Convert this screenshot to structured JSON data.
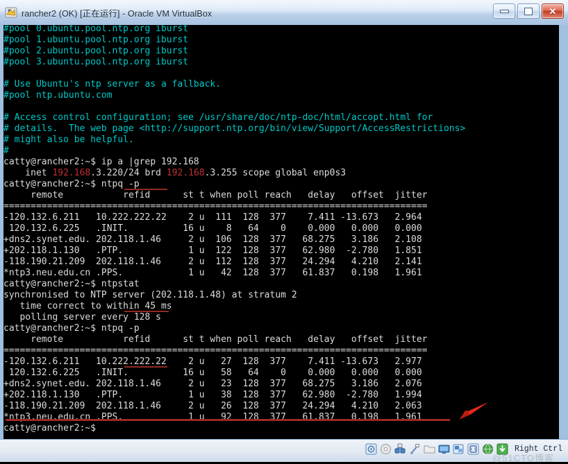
{
  "window": {
    "title": "rancher2 (OK) [正在运行] - Oracle VM VirtualBox",
    "icon": "virtualbox-icon",
    "controls": {
      "minimize": "–",
      "maximize": "□",
      "close": "✕"
    },
    "accent_blue": "#a7c3e2",
    "close_red": "#c43a22"
  },
  "terminal": {
    "background": "#000000",
    "foreground": "#d8d8d8",
    "comment_color": "#00c8c8",
    "highlight_color": "#c03030",
    "prompt": "catty@rancher2:~$",
    "lines": [
      {
        "segs": [
          {
            "t": "#pool 0.ubuntu.pool.ntp.org iburst",
            "c": "cyan"
          }
        ]
      },
      {
        "segs": [
          {
            "t": "#pool 1.ubuntu.pool.ntp.org iburst",
            "c": "cyan"
          }
        ]
      },
      {
        "segs": [
          {
            "t": "#pool 2.ubuntu.pool.ntp.org iburst",
            "c": "cyan"
          }
        ]
      },
      {
        "segs": [
          {
            "t": "#pool 3.ubuntu.pool.ntp.org iburst",
            "c": "cyan"
          }
        ]
      },
      {
        "segs": [
          {
            "t": "",
            "c": "white"
          }
        ]
      },
      {
        "segs": [
          {
            "t": "# Use Ubuntu's ntp server as a fallback.",
            "c": "cyan"
          }
        ]
      },
      {
        "segs": [
          {
            "t": "#pool ntp.ubuntu.com",
            "c": "cyan"
          }
        ]
      },
      {
        "segs": [
          {
            "t": "",
            "c": "white"
          }
        ]
      },
      {
        "segs": [
          {
            "t": "# Access control configuration; see /usr/share/doc/ntp-doc/html/accopt.html for",
            "c": "cyan"
          }
        ]
      },
      {
        "segs": [
          {
            "t": "# details.  The web page <http://support.ntp.org/bin/view/Support/AccessRestrictions>",
            "c": "cyan"
          }
        ]
      },
      {
        "segs": [
          {
            "t": "# might also be helpful.",
            "c": "cyan"
          }
        ]
      },
      {
        "segs": [
          {
            "t": "#",
            "c": "cyan"
          }
        ]
      },
      {
        "segs": [
          {
            "t": "catty@rancher2:~$ ip a |grep 192.168",
            "c": "white"
          }
        ]
      },
      {
        "segs": [
          {
            "t": "    inet ",
            "c": "white"
          },
          {
            "t": "192.168",
            "c": "red"
          },
          {
            "t": ".3.220/24 brd ",
            "c": "white"
          },
          {
            "t": "192.168",
            "c": "red"
          },
          {
            "t": ".3.255 scope global enp0s3",
            "c": "white"
          }
        ]
      },
      {
        "segs": [
          {
            "t": "catty@rancher2:~$ ntpq -p",
            "c": "white"
          }
        ]
      },
      {
        "segs": [
          {
            "t": "     remote           refid      st t when poll reach   delay   offset  jitter",
            "c": "white"
          }
        ]
      },
      {
        "segs": [
          {
            "t": "==============================================================================",
            "c": "white"
          }
        ]
      },
      {
        "segs": [
          {
            "t": "-120.132.6.211   10.222.222.22    2 u  111  128  377    7.411 -13.673   2.964",
            "c": "white"
          }
        ]
      },
      {
        "segs": [
          {
            "t": " 120.132.6.225   .INIT.          16 u    8   64    0    0.000   0.000   0.000",
            "c": "white"
          }
        ]
      },
      {
        "segs": [
          {
            "t": "+dns2.synet.edu. 202.118.1.46     2 u  106  128  377   68.275   3.186   2.108",
            "c": "white"
          }
        ]
      },
      {
        "segs": [
          {
            "t": "+202.118.1.130   .PTP.            1 u  122  128  377   62.980  -2.780   1.851",
            "c": "white"
          }
        ]
      },
      {
        "segs": [
          {
            "t": "-118.190.21.209  202.118.1.46     2 u  112  128  377   24.294   4.210   2.141",
            "c": "white"
          }
        ]
      },
      {
        "segs": [
          {
            "t": "*ntp3.neu.edu.cn .PPS.            1 u   42  128  377   61.837   0.198   1.961",
            "c": "white"
          }
        ]
      },
      {
        "segs": [
          {
            "t": "catty@rancher2:~$ ntpstat",
            "c": "white"
          }
        ]
      },
      {
        "segs": [
          {
            "t": "synchronised to NTP server (202.118.1.48) at stratum 2",
            "c": "white"
          }
        ]
      },
      {
        "segs": [
          {
            "t": "   time correct to within 45 ms",
            "c": "white"
          }
        ]
      },
      {
        "segs": [
          {
            "t": "   polling server every 128 s",
            "c": "white"
          }
        ]
      },
      {
        "segs": [
          {
            "t": "catty@rancher2:~$ ntpq -p",
            "c": "white"
          }
        ]
      },
      {
        "segs": [
          {
            "t": "     remote           refid      st t when poll reach   delay   offset  jitter",
            "c": "white"
          }
        ]
      },
      {
        "segs": [
          {
            "t": "==============================================================================",
            "c": "white"
          }
        ]
      },
      {
        "segs": [
          {
            "t": "-120.132.6.211   10.222.222.22    2 u   27  128  377    7.411 -13.673   2.977",
            "c": "white"
          }
        ]
      },
      {
        "segs": [
          {
            "t": " 120.132.6.225   .INIT.          16 u   58   64    0    0.000   0.000   0.000",
            "c": "white"
          }
        ]
      },
      {
        "segs": [
          {
            "t": "+dns2.synet.edu. 202.118.1.46     2 u   23  128  377   68.275   3.186   2.076",
            "c": "white"
          }
        ]
      },
      {
        "segs": [
          {
            "t": "+202.118.1.130   .PTP.            1 u   38  128  377   62.980  -2.780   1.994",
            "c": "white"
          }
        ]
      },
      {
        "segs": [
          {
            "t": "-118.190.21.209  202.118.1.46     2 u   26  128  377   24.294   4.210   2.063",
            "c": "white"
          }
        ]
      },
      {
        "segs": [
          {
            "t": "*ntp3.neu.edu.cn .PPS.            1 u   92  128  377   61.837   0.198   1.961",
            "c": "white"
          }
        ]
      },
      {
        "segs": [
          {
            "t": "catty@rancher2:~$",
            "c": "white"
          }
        ]
      }
    ],
    "ntpq_table": {
      "columns": [
        "remote",
        "refid",
        "st",
        "t",
        "when",
        "poll",
        "reach",
        "delay",
        "offset",
        "jitter"
      ],
      "first_run": [
        [
          "-120.132.6.211",
          "10.222.222.22",
          "2",
          "u",
          "111",
          "128",
          "377",
          "7.411",
          "-13.673",
          "2.964"
        ],
        [
          " 120.132.6.225",
          ".INIT.",
          "16",
          "u",
          "8",
          "64",
          "0",
          "0.000",
          "0.000",
          "0.000"
        ],
        [
          "+dns2.synet.edu.",
          "202.118.1.46",
          "2",
          "u",
          "106",
          "128",
          "377",
          "68.275",
          "3.186",
          "2.108"
        ],
        [
          "+202.118.1.130",
          ".PTP.",
          "1",
          "u",
          "122",
          "128",
          "377",
          "62.980",
          "-2.780",
          "1.851"
        ],
        [
          "-118.190.21.209",
          "202.118.1.46",
          "2",
          "u",
          "112",
          "128",
          "377",
          "24.294",
          "4.210",
          "2.141"
        ],
        [
          "*ntp3.neu.edu.cn",
          ".PPS.",
          "1",
          "u",
          "42",
          "128",
          "377",
          "61.837",
          "0.198",
          "1.961"
        ]
      ],
      "second_run": [
        [
          "-120.132.6.211",
          "10.222.222.22",
          "2",
          "u",
          "27",
          "128",
          "377",
          "7.411",
          "-13.673",
          "2.977"
        ],
        [
          " 120.132.6.225",
          ".INIT.",
          "16",
          "u",
          "58",
          "64",
          "0",
          "0.000",
          "0.000",
          "0.000"
        ],
        [
          "+dns2.synet.edu.",
          "202.118.1.46",
          "2",
          "u",
          "23",
          "128",
          "377",
          "68.275",
          "3.186",
          "2.076"
        ],
        [
          "+202.118.1.130",
          ".PTP.",
          "1",
          "u",
          "38",
          "128",
          "377",
          "62.980",
          "-2.780",
          "1.994"
        ],
        [
          "-118.190.21.209",
          "202.118.1.46",
          "2",
          "u",
          "26",
          "128",
          "377",
          "24.294",
          "4.210",
          "2.063"
        ],
        [
          "*ntp3.neu.edu.cn",
          ".PPS.",
          "1",
          "u",
          "92",
          "128",
          "377",
          "61.837",
          "0.198",
          "1.961"
        ]
      ]
    },
    "ntpstat_output": {
      "synchronised": "synchronised to NTP server (202.118.1.48) at stratum 2",
      "accuracy": "time correct to within 45 ms",
      "polling": "polling server every 128 s"
    },
    "annotations": {
      "color": "#9e2a23",
      "underlines": [
        "ntpq -p",
        "ntpstat",
        "ntpq -p",
        "*ntp3.neu.edu.cn .PPS. row"
      ],
      "arrow": "red-arrow-pointing-left"
    }
  },
  "statusbar": {
    "icons": [
      "hard-disk-icon",
      "optical-disk-icon",
      "network-icon",
      "usb-icon",
      "shared-folder-icon",
      "display-icon",
      "remote-desktop-icon",
      "video-capture-icon",
      "globe-icon",
      "host-key-icon"
    ],
    "host_key_label": "Right Ctrl",
    "watermark": "@51CTO博客"
  }
}
